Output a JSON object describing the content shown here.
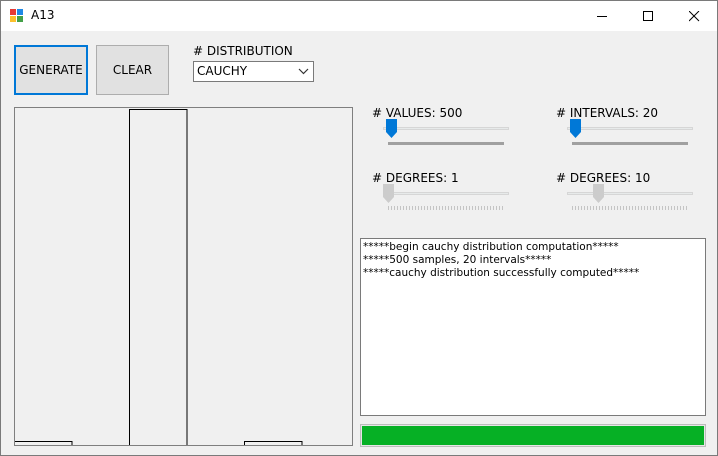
{
  "window": {
    "title": "A13",
    "minimize_icon": "minimize-icon",
    "maximize_icon": "maximize-icon",
    "close_icon": "close-icon"
  },
  "buttons": {
    "generate": "GENERATE",
    "clear": "CLEAR"
  },
  "distribution": {
    "label": "# DISTRIBUTION",
    "selected": "CAUCHY"
  },
  "sliders": [
    {
      "id": "values",
      "label": "# VALUES: 500",
      "level": 0.03,
      "enabled": true
    },
    {
      "id": "intervals",
      "label": "# INTERVALS: 20",
      "level": 0.03,
      "enabled": true
    },
    {
      "id": "degrees1",
      "label": "# DEGREES: 1",
      "level": 0.0,
      "enabled": false
    },
    {
      "id": "degrees2",
      "label": "# DEGREES: 10",
      "level": 0.22,
      "enabled": false
    }
  ],
  "log": [
    "*****begin cauchy distribution computation*****",
    "*****500 samples, 20 intervals*****",
    "*****cauchy distribution successfully computed*****"
  ],
  "progress": 1.0,
  "colors": {
    "accent": "#0078d7",
    "progress": "#06b025",
    "disabled_thumb": "#cccccc"
  },
  "chart_data": {
    "type": "bar",
    "bar_heights_relative": [
      0,
      0,
      0,
      0,
      0,
      0,
      0,
      0.012,
      0,
      1.0,
      0,
      0.012,
      0,
      0,
      0,
      0,
      0,
      0,
      0,
      0
    ]
  }
}
